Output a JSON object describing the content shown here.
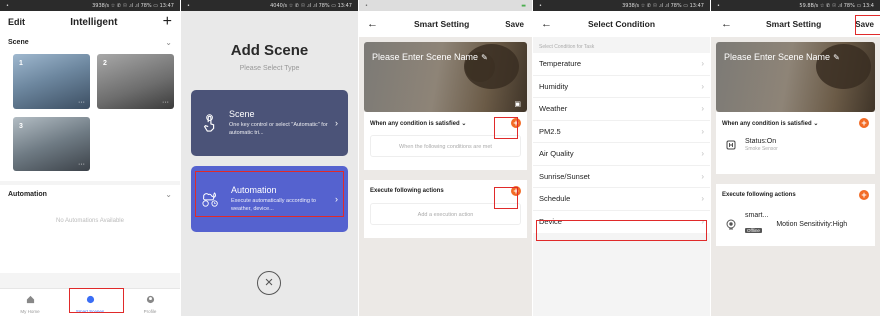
{
  "status_bars": {
    "p1": {
      "left": "•",
      "right": "3938/s ☆ ✆ ☉ .ıl .ıl 78% ▭ 13:47"
    },
    "p2": {
      "left": "•",
      "right": "4040/s ☆ ✆ ☉ .ıl .ıl 78% ▭ 13:47"
    },
    "p3": {
      "left": "•",
      "right": "▬"
    },
    "p4": {
      "left": "•",
      "right": "3938/s ☆ ✆ ☉ .ıl .ıl 78% ▭ 13:47"
    },
    "p5": {
      "left": "•",
      "right": "59.8B/s ☆ ✆ ☉ .ıl 78% ▭ 13:4"
    }
  },
  "panel1": {
    "edit": "Edit",
    "title": "Intelligent",
    "add": "+",
    "scene_header": "Scene",
    "scene_cards": [
      "1",
      "2",
      "3"
    ],
    "automation_header": "Automation",
    "no_automation": "No Automations Available",
    "nav": [
      {
        "label": "My Home",
        "icon": "home-icon"
      },
      {
        "label": "Smart Scenes",
        "icon": "smart-scenes-icon"
      },
      {
        "label": "Profile",
        "icon": "profile-icon"
      }
    ]
  },
  "panel2": {
    "title": "Add Scene",
    "subtitle": "Please Select Type",
    "scene_card": {
      "title": "Scene",
      "desc": "One key control or select \"Automatic\" for automatic tri..."
    },
    "auto_card": {
      "title": "Automation",
      "desc": "Execute automatically according to weather, device..."
    },
    "close": "×"
  },
  "panel3": {
    "back": "←",
    "title": "Smart Setting",
    "save": "Save",
    "hero_text": "Please Enter Scene Name",
    "condition_label": "When any condition is satisfied",
    "condition_placeholder": "When the following conditions are met",
    "actions_label": "Execute following actions",
    "actions_placeholder": "Add a execution action"
  },
  "panel4": {
    "back": "←",
    "title": "Select Condition",
    "section": "Select Condition for Task",
    "items": [
      "Temperature",
      "Humidity",
      "Weather",
      "PM2.5",
      "Air Quality",
      "Sunrise/Sunset",
      "Schedule",
      "Device"
    ]
  },
  "panel5": {
    "back": "←",
    "title": "Smart Setting",
    "save": "Save",
    "hero_text": "Please Enter Scene Name",
    "condition_label": "When any condition is satisfied",
    "condition_item": {
      "title": "Status:On",
      "sub": "Smoke Sensor"
    },
    "actions_label": "Execute following actions",
    "action_item": {
      "title": "smart...",
      "badge": "Offline",
      "detail": "Motion Sensitivity:High"
    }
  },
  "colors": {
    "accent_orange": "#f26b25",
    "highlight_red": "#e02a2a",
    "scene_card": "#4b5378",
    "auto_card": "#5562cf",
    "nav_active": "#3b6ef5"
  }
}
